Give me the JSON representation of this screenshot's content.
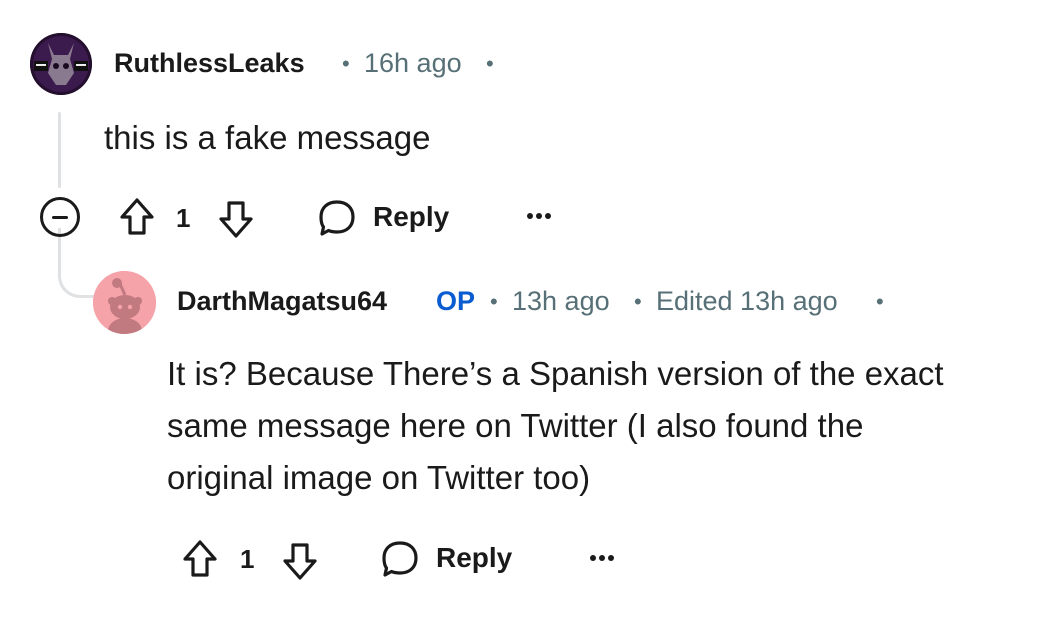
{
  "comments": [
    {
      "author": "RuthlessLeaks",
      "time": "16h ago",
      "body": "this is a fake message",
      "score": "1",
      "reply_label": "Reply"
    },
    {
      "author": "DarthMagatsu64",
      "op_badge": "OP",
      "time": "13h ago",
      "edited": "Edited 13h ago",
      "body_lines": [
        "It is? Because There’s a Spanish version of the exact",
        "same message here on Twitter (I also found the",
        "original image on Twitter too)"
      ],
      "score": "1",
      "reply_label": "Reply"
    }
  ],
  "colors": {
    "text": "#1a1a1b",
    "meta": "#576f76",
    "op_badge": "#0a5cd0",
    "thread_line": "#dfe1e3",
    "default_avatar_bg": "#f5a2a9"
  }
}
